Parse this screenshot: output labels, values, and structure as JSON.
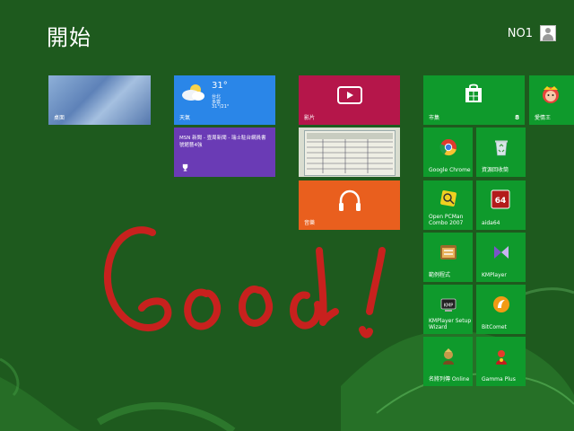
{
  "header": {
    "title": "開始",
    "user": "NO1"
  },
  "tiles": {
    "desktop": "桌面",
    "weather": {
      "label": "天氣",
      "temp": "31°",
      "city": "台北",
      "cond": "多雲",
      "range": "31°/21°"
    },
    "msn": "MSN 新聞 - 壹周新聞 - 瑞士駐台網員書號館藝4強",
    "video": "影片",
    "music": "音樂",
    "store": {
      "label": "市集",
      "count": "8"
    },
    "heart": "愛情王",
    "chrome": "Google Chrome",
    "recycle": "資源回收筒",
    "pcman": "Open PCMan Combo 2007",
    "aida": "aida64",
    "aida_icon": "64",
    "apps": "範例程式",
    "kmp": "KMPlayer",
    "kmsetup": "KMPlayer Setup Wizard",
    "bitcomet": "BitComet",
    "game1": "名將列傳 Online",
    "gamma": "Gamma Plus"
  },
  "writing": {
    "text": "Good!",
    "color": "#d21f1f"
  },
  "colors": {
    "background": "#1e5a1e",
    "tile_green": "#0f9a2c",
    "weather": "#2a86e8",
    "msn": "#6a3bb5",
    "video": "#b5164a",
    "music": "#e95f1e"
  }
}
